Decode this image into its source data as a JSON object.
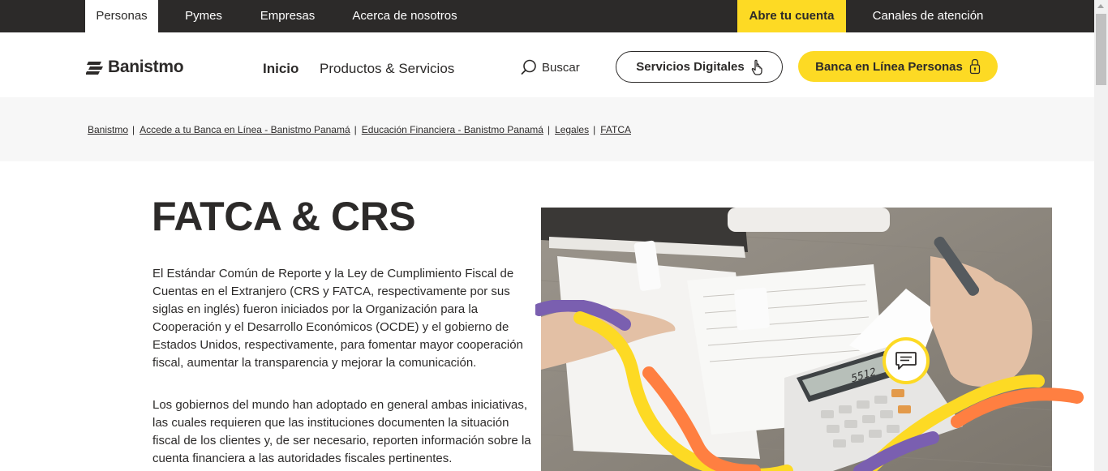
{
  "topbar": {
    "tabs": [
      {
        "label": "Personas"
      },
      {
        "label": "Pymes"
      },
      {
        "label": "Empresas"
      },
      {
        "label": "Acerca de nosotros"
      }
    ],
    "cta": "Abre tu cuenta",
    "support": "Canales de atención"
  },
  "header": {
    "logo_text": "Banistmo",
    "nav": [
      {
        "label": "Inicio"
      },
      {
        "label": "Productos & Servicios"
      }
    ],
    "search_label": "Buscar",
    "digital_services": "Servicios Digitales",
    "online_banking": "Banca en Línea Personas"
  },
  "breadcrumb": [
    {
      "label": "Banistmo"
    },
    {
      "label": "Accede a tu Banca en Línea - Banistmo Panamá"
    },
    {
      "label": "Educación Financiera - Banistmo Panamá"
    },
    {
      "label": "Legales"
    },
    {
      "label": "FATCA"
    }
  ],
  "breadcrumb_separator": "|",
  "main": {
    "title": "FATCA & CRS",
    "paragraph1": "El Estándar Común de Reporte y la Ley de Cumplimiento Fiscal de Cuentas en el Extranjero (CRS y FATCA, respectivamente por sus siglas en inglés) fueron iniciados por la Organización para la Cooperación y el Desarrollo Económicos (OCDE) y el gobierno de Estados Unidos, respectivamente, para fomentar mayor cooperación fiscal, aumentar la transparencia y mejorar la comunicación.",
    "paragraph2": "Los gobiernos del mundo han adoptado en general ambas iniciativas, las cuales requieren que las instituciones documenten la situación fiscal de los clientes y, de ser necesario, reporten información sobre la cuenta financiera a las autoridades fiscales pertinentes.",
    "calculator_display": "5512"
  },
  "colors": {
    "dark": "#2c2a29",
    "yellow": "#fdda24",
    "orange": "#ff7f41",
    "purple": "#7a5fb0",
    "breadcrumb_bg": "#f7f7f7"
  },
  "icons": {
    "search": "search-icon",
    "digital": "touch-hand-icon",
    "lock": "lock-icon",
    "chat": "chat-icon",
    "logo": "banistmo-logo-mark"
  }
}
